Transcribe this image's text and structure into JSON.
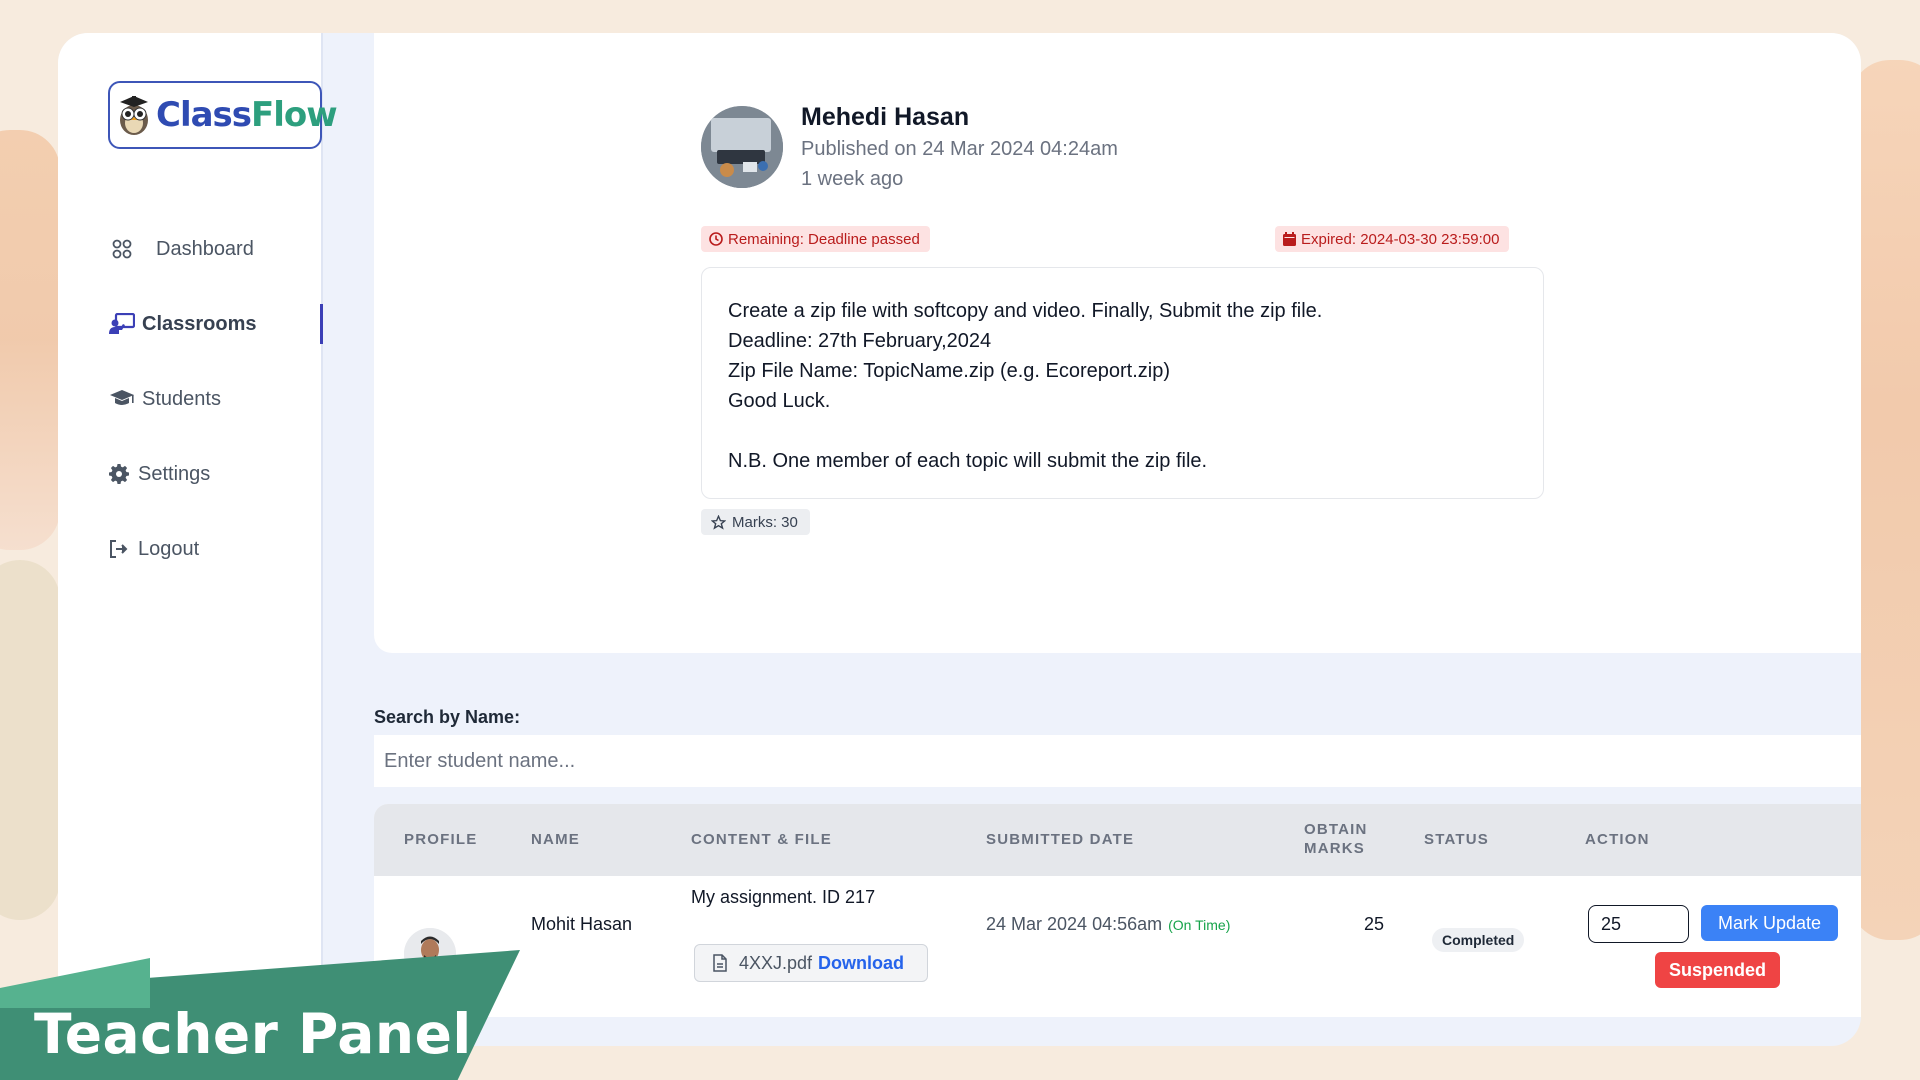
{
  "app": {
    "logo_text_1": "Class",
    "logo_text_2": "Flow",
    "accent": "#3b3fb6",
    "brand_blue": "#2f4bb2",
    "brand_green": "#2d9f7e"
  },
  "sidebar": {
    "items": [
      {
        "label": "Dashboard",
        "icon": "grid-icon",
        "active": false
      },
      {
        "label": "Classrooms",
        "icon": "classroom-icon",
        "active": true
      },
      {
        "label": "Students",
        "icon": "graduation-cap-icon",
        "active": false
      },
      {
        "label": "Settings",
        "icon": "gear-icon",
        "active": false
      },
      {
        "label": "Logout",
        "icon": "logout-icon",
        "active": false
      }
    ]
  },
  "post": {
    "author": "Mehedi Hasan",
    "published": "Published on 24 Mar 2024 04:24am",
    "ago": "1 week ago",
    "remaining": "Remaining: Deadline passed",
    "expired": "Expired: 2024-03-30 23:59:00",
    "lines": [
      "Create a zip file with softcopy and video. Finally, Submit the zip file.",
      "Deadline: 27th February,2024",
      "Zip File Name: TopicName.zip (e.g. Ecoreport.zip)",
      "Good Luck.",
      "",
      "N.B. One member of each topic will submit the zip file."
    ],
    "marks": "Marks: 30"
  },
  "search": {
    "label": "Search by Name:",
    "placeholder": "Enter student name...",
    "value": ""
  },
  "table": {
    "headers": {
      "profile": "PROFILE",
      "name": "NAME",
      "content": "CONTENT & FILE",
      "submitted": "SUBMITTED DATE",
      "marks_1": "OBTAIN",
      "marks_2": "MARKS",
      "status": "STATUS",
      "action": "ACTION"
    },
    "rows": [
      {
        "name": "Mohit Hasan",
        "content": "My assignment. ID 217",
        "file": "4XXJ.pdf",
        "download": "Download",
        "submitted": "24 Mar 2024 04:56am",
        "on_time": "(On Time)",
        "marks": "25",
        "status": "Completed",
        "mark_input": "25",
        "update_label": "Mark Update",
        "suspend_label": "Suspended"
      }
    ]
  },
  "banner": {
    "text": "Teacher Panel"
  }
}
